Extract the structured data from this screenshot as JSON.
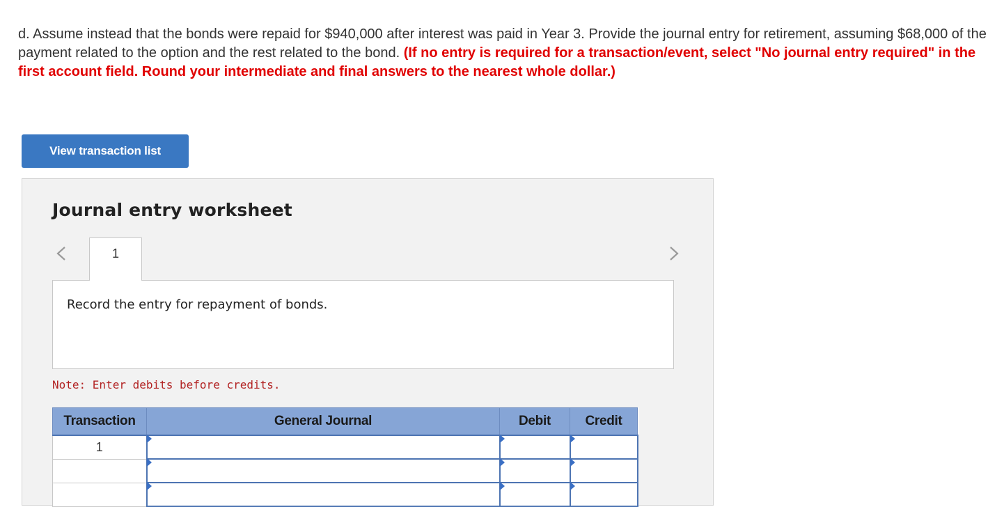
{
  "question": {
    "text": "d. Assume instead that the bonds were repaid for $940,000 after interest was paid in Year 3. Provide the journal entry for retirement, assuming $68,000 of the payment related to the option and the rest related to the bond.",
    "instruction": "(If no entry is required for a transaction/event, select \"No journal entry required\" in the first account field. Round your intermediate and final answers to the nearest whole dollar.)"
  },
  "view_button": {
    "label": "View transaction list"
  },
  "worksheet": {
    "title": "Journal entry worksheet",
    "nav_prev_icon": "chevron-left-icon",
    "nav_next_icon": "chevron-right-icon",
    "active_tab": "1",
    "prompt": "Record the entry for repayment of bonds.",
    "note": "Note: Enter debits before credits.",
    "table": {
      "headers": [
        "Transaction",
        "General Journal",
        "Debit",
        "Credit"
      ],
      "rows": [
        {
          "transaction": "1",
          "account": "",
          "debit": "",
          "credit": ""
        },
        {
          "transaction": "",
          "account": "",
          "debit": "",
          "credit": ""
        },
        {
          "transaction": "",
          "account": "",
          "debit": "",
          "credit": ""
        }
      ]
    }
  },
  "colors": {
    "instruction_red": "#e00000",
    "button_blue": "#3a78c2",
    "table_header_blue": "#86a5d6",
    "input_border_blue": "#4d74b2",
    "note_red": "#b22222"
  }
}
